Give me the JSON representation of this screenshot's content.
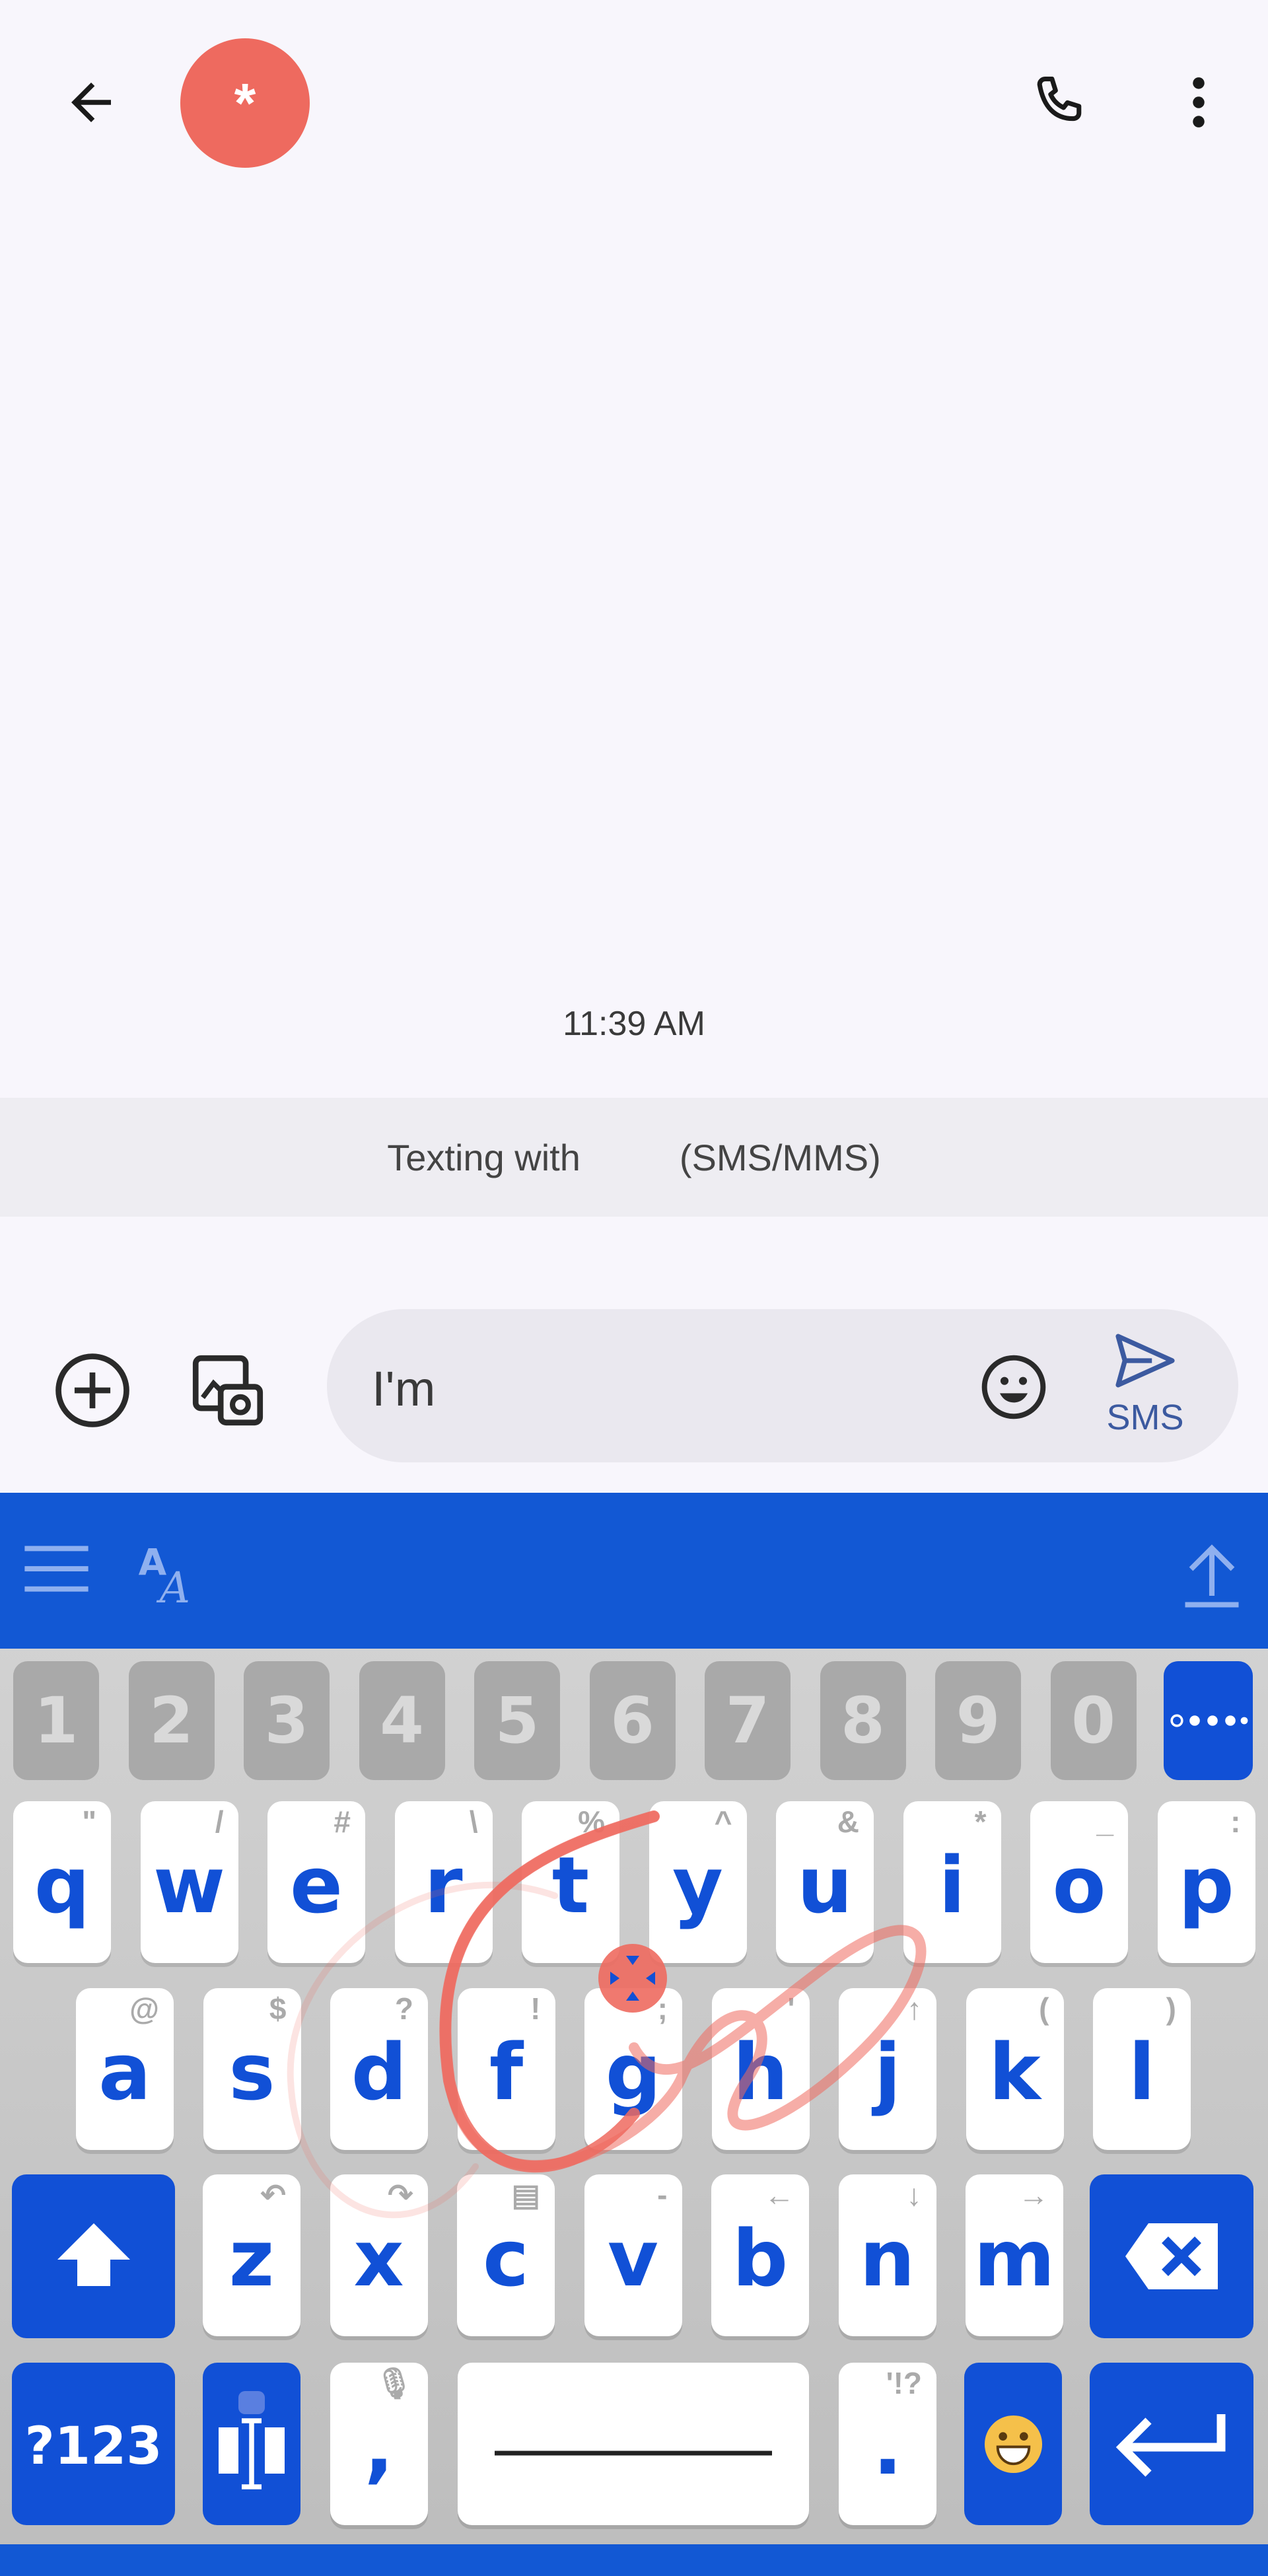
{
  "header": {
    "back_icon": "arrow-left-icon",
    "avatar_text": "*",
    "avatar_color": "#ee6a5f",
    "call_icon": "phone-icon",
    "menu_icon": "more-vert-icon"
  },
  "conversation": {
    "timestamp": "11:39 AM",
    "banner_left": "Texting with",
    "banner_right": "(SMS/MMS)"
  },
  "composer": {
    "add_icon": "plus-circle-icon",
    "gallery_icon": "image-camera-icon",
    "text": "I'm",
    "emoji_icon": "smiley-icon",
    "send_icon": "send-icon",
    "send_label": "SMS"
  },
  "keyboard": {
    "accent_color": "#1150d6",
    "toolbar": {
      "menu_icon": "hamburger-icon",
      "font_icon": "font-style-icon",
      "collapse_icon": "upload-arrow-icon"
    },
    "number_row": [
      "1",
      "2",
      "3",
      "4",
      "5",
      "6",
      "7",
      "8",
      "9",
      "0"
    ],
    "more_icon": "more-dots-icon",
    "row1": [
      {
        "key": "q",
        "hint": "\""
      },
      {
        "key": "w",
        "hint": "/"
      },
      {
        "key": "e",
        "hint": "#"
      },
      {
        "key": "r",
        "hint": "\\"
      },
      {
        "key": "t",
        "hint": "%"
      },
      {
        "key": "y",
        "hint": "^"
      },
      {
        "key": "u",
        "hint": "&"
      },
      {
        "key": "i",
        "hint": "*"
      },
      {
        "key": "o",
        "hint": "_"
      },
      {
        "key": "p",
        "hint": ":"
      }
    ],
    "row2": [
      {
        "key": "a",
        "hint": "@"
      },
      {
        "key": "s",
        "hint": "$"
      },
      {
        "key": "d",
        "hint": "?"
      },
      {
        "key": "f",
        "hint": "!"
      },
      {
        "key": "g",
        "hint": ";"
      },
      {
        "key": "h",
        "hint": "'"
      },
      {
        "key": "j",
        "hint": "↑"
      },
      {
        "key": "k",
        "hint": "("
      },
      {
        "key": "l",
        "hint": ")"
      }
    ],
    "row3": [
      {
        "key": "z",
        "hint": "↶"
      },
      {
        "key": "x",
        "hint": "↷"
      },
      {
        "key": "c",
        "hint": "▤"
      },
      {
        "key": "v",
        "hint": "-"
      },
      {
        "key": "b",
        "hint": "←"
      },
      {
        "key": "n",
        "hint": "↓"
      },
      {
        "key": "m",
        "hint": "→"
      }
    ],
    "shift_icon": "shift-arrow-icon",
    "backspace_icon": "backspace-icon",
    "symbols_label": "?123",
    "cursor_icon": "text-cursor-icon",
    "comma_label": ",",
    "comma_hint": "🎙",
    "period_label": ".",
    "period_hint": "'!?",
    "emoji_icon": "grin-emoji-icon",
    "enter_icon": "enter-arrow-icon"
  }
}
